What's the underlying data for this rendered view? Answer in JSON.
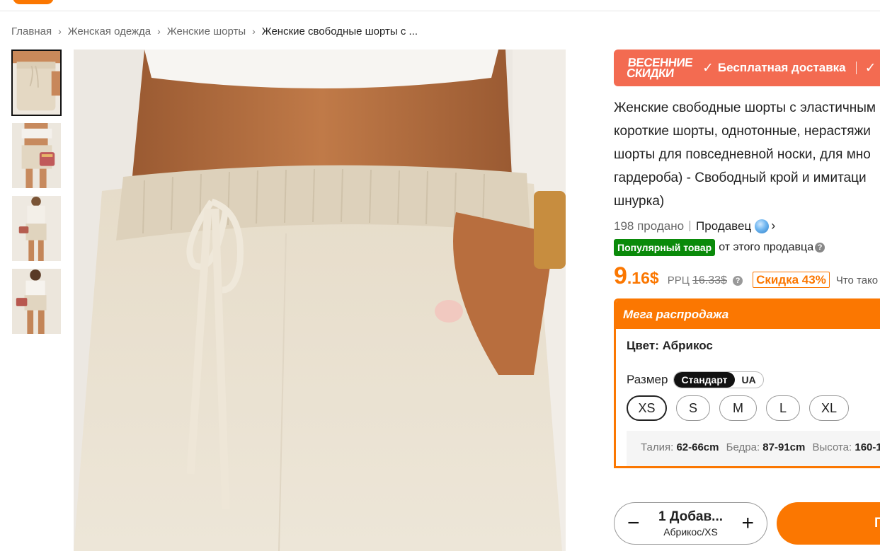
{
  "breadcrumb": {
    "items": [
      "Главная",
      "Женская одежда",
      "Женские шорты"
    ],
    "current": "Женские свободные шорты с ..."
  },
  "gallery": {
    "thumbnails": [
      "thumb-1",
      "thumb-2",
      "thumb-3",
      "thumb-4"
    ],
    "selected_index": 0
  },
  "promo": {
    "spring_line1": "ВЕСЕННИЕ",
    "spring_line2": "СКИДКИ",
    "check": "✓",
    "free_delivery": "Бесплатная доставка"
  },
  "product": {
    "title_lines": [
      "Женские свободные шорты с эластичным",
      "короткие шорты, однотонные, нерастяжи",
      "шорты для повседневной носки, для мно",
      "гардероба) - Свободный крой и имитаци",
      "шнурка)"
    ],
    "sold": "198 продано",
    "seller_label": "Продавец",
    "popular_badge": "Популярный товар",
    "popular_from": "от этого продавца",
    "price_int": "9",
    "price_frac": ".16$",
    "rrp_label": "РРЦ",
    "rrp_value": "16.33$",
    "discount": "Скидка 43%",
    "what_is": "Что тако"
  },
  "mega_sale": {
    "title": "Мега распродажа",
    "color_label": "Цвет: Абрикос",
    "size_label": "Размер",
    "size_standard": "Стандарт",
    "size_ua": "UA",
    "sizes": [
      "XS",
      "S",
      "M",
      "L",
      "XL"
    ],
    "selected_size": "XS",
    "measurements": {
      "waist_label": "Талия:",
      "waist_value": "62-66cm",
      "hips_label": "Бедра:",
      "hips_value": "87-91cm",
      "height_label": "Высота:",
      "height_value": "160-1"
    }
  },
  "cart": {
    "minus": "−",
    "plus": "+",
    "qty_label": "1 Добав...",
    "variant": "Абрикос/XS",
    "add_button": "П"
  },
  "colors": {
    "accent": "#fb7701",
    "promo": "#f36b51",
    "popular": "#0a8a0a"
  }
}
